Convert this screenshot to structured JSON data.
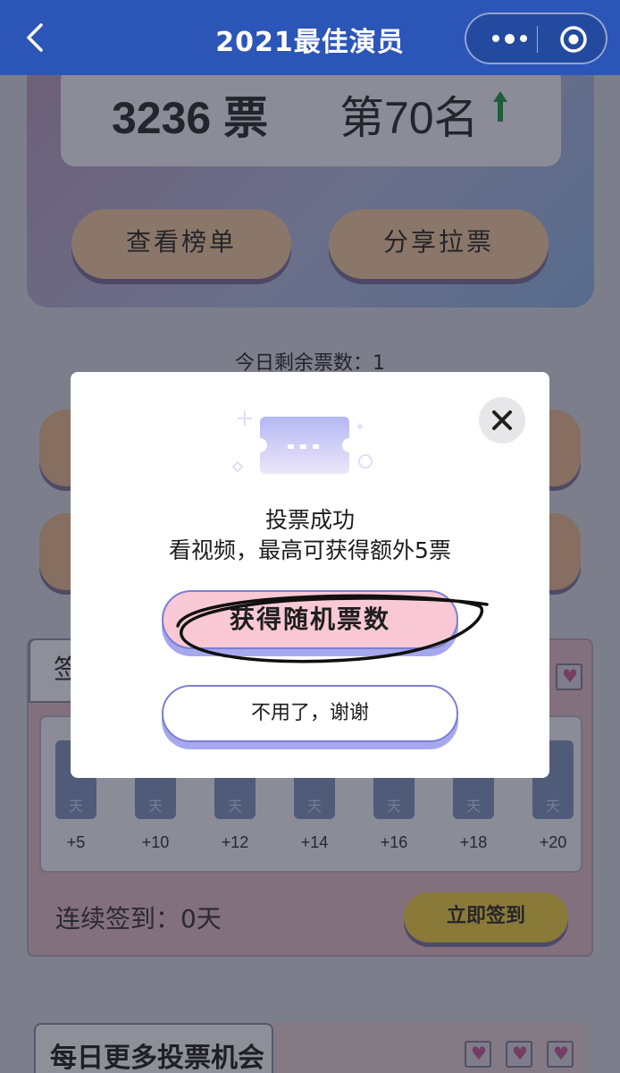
{
  "navbar": {
    "title": "2021最佳演员",
    "back_icon": "chevron-left-icon",
    "more_icon": "more-dots-icon",
    "close_mini_icon": "target-circle-icon",
    "bg_color": "#2c55b8"
  },
  "hero": {
    "votes": "3236 票",
    "rank": "第70名",
    "rank_trend_icon": "arrow-up-icon",
    "ranklist_button": "查看榜单",
    "share_button": "分享拉票"
  },
  "remaining_votes": "今日剩余票数：1",
  "signin": {
    "tab_label": "签",
    "days": [
      {
        "label": "天",
        "reward": "+5"
      },
      {
        "label": "天",
        "reward": "+10"
      },
      {
        "label": "天",
        "reward": "+12"
      },
      {
        "label": "天",
        "reward": "+14"
      },
      {
        "label": "天",
        "reward": "+16"
      },
      {
        "label": "天",
        "reward": "+18"
      },
      {
        "label": "天",
        "reward": "+20"
      }
    ],
    "streak": "连续签到：0天",
    "signin_button": "立即签到"
  },
  "more_chances": {
    "title": "每日更多投票机会"
  },
  "modal": {
    "success": "投票成功",
    "bonus": "看视频，最高可获得额外5票",
    "random_button": "获得随机票数",
    "decline_button": "不用了，谢谢",
    "close_icon": "close-icon",
    "ticket_icon": "ticket-icon",
    "accent": "#a6a8ee",
    "primary_fill": "#f8c9d5"
  }
}
